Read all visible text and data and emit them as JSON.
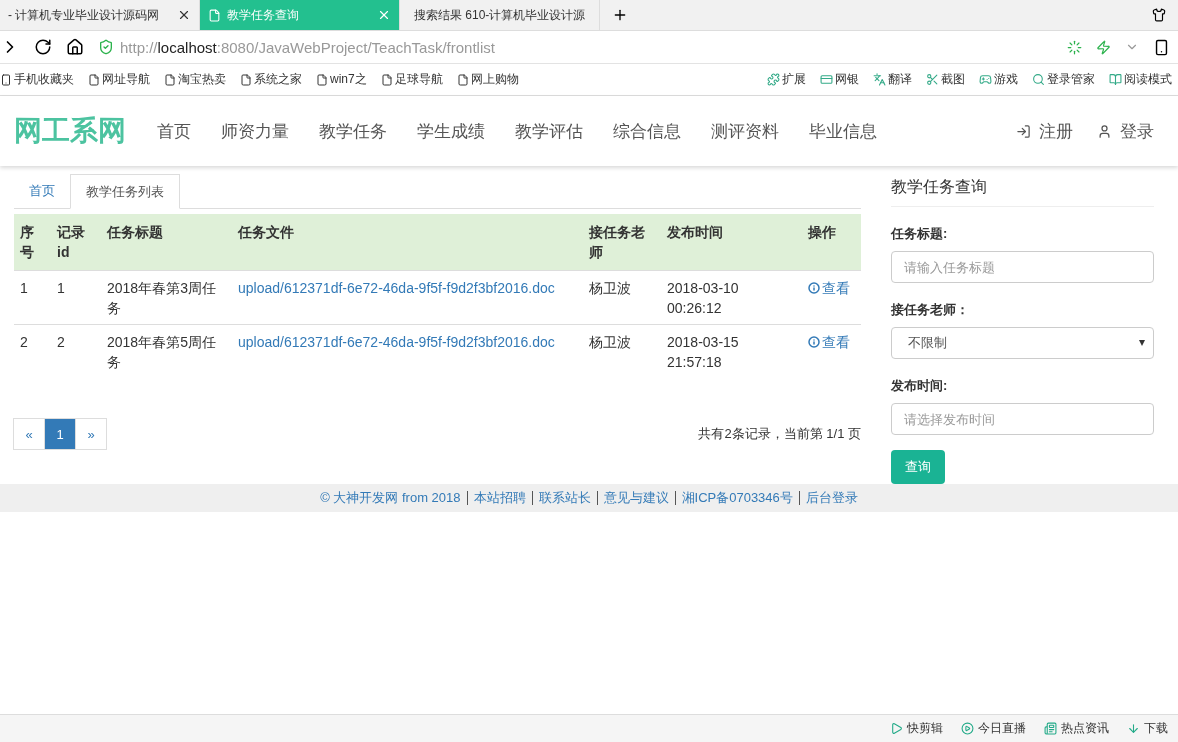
{
  "browser": {
    "tabs": [
      {
        "label": "- 计算机专业毕业设计源码网",
        "selected": false
      },
      {
        "label": "教学任务查询",
        "selected": true
      },
      {
        "label": "搜索结果 610-计算机毕业设计源",
        "selected": false
      }
    ],
    "address": "http://**localhost**:8080/JavaWebProject/TeachTask/frontlist",
    "bookmarks": [
      "手机收藏夹",
      "网址导航",
      "淘宝热卖",
      "系统之家",
      "win7之",
      "足球导航",
      "网上购物"
    ],
    "tools": [
      "扩展",
      "网银",
      "翻译",
      "截图",
      "游戏",
      "登录管家",
      "阅读模式"
    ]
  },
  "site": {
    "logo": "网工系网",
    "nav": [
      "首页",
      "师资力量",
      "教学任务",
      "学生成绩",
      "教学评估",
      "综合信息",
      "测评资料",
      "毕业信息"
    ],
    "account": [
      {
        "kind": "register",
        "label": "注册"
      },
      {
        "kind": "login",
        "label": "登录"
      }
    ]
  },
  "breadcrumb": [
    {
      "label": "首页",
      "selected": false
    },
    {
      "label": "教学任务列表",
      "selected": true
    }
  ],
  "table": {
    "columns": [
      "序号",
      "记录id",
      "任务标题",
      "任务文件",
      "接任务老师",
      "发布时间",
      "操作"
    ],
    "rows": [
      {
        "cells": [
          "1",
          "1",
          "2018年春第3周任务",
          "upload/612371df-6e72-46da-9f5f-f9d2f3bf2016.doc",
          "杨卫波",
          "2018-03-10 00:26:12"
        ],
        "action": "查看"
      },
      {
        "cells": [
          "2",
          "2",
          "2018年春第5周任务",
          "upload/612371df-6e72-46da-9f5f-f9d2f3bf2016.doc",
          "杨卫波",
          "2018-03-15 21:57:18"
        ],
        "action": "查看"
      }
    ]
  },
  "pagination": {
    "prev": "«",
    "pages": [
      {
        "label": "1",
        "selected": true
      }
    ],
    "next": "»"
  },
  "summary": "共有2条记录，当前第 1/1 页",
  "search_panel": {
    "title": "教学任务查询",
    "fields": [
      {
        "kind": "text",
        "label": "任务标题:",
        "placeholder": "请输入任务标题"
      },
      {
        "kind": "select",
        "label": "接任务老师：",
        "value": "不限制"
      },
      {
        "kind": "text",
        "label": "发布时间:",
        "placeholder": "请选择发布时间"
      }
    ],
    "button": "查询"
  },
  "footer": {
    "copyright": "© 大神开发网 from 2018",
    "links": [
      "本站招聘",
      "联系站长",
      "意见与建议",
      "湘ICP备0703346号",
      "后台登录"
    ]
  },
  "status_bar": [
    "快剪辑",
    "今日直播",
    "热点资讯",
    "下载"
  ]
}
